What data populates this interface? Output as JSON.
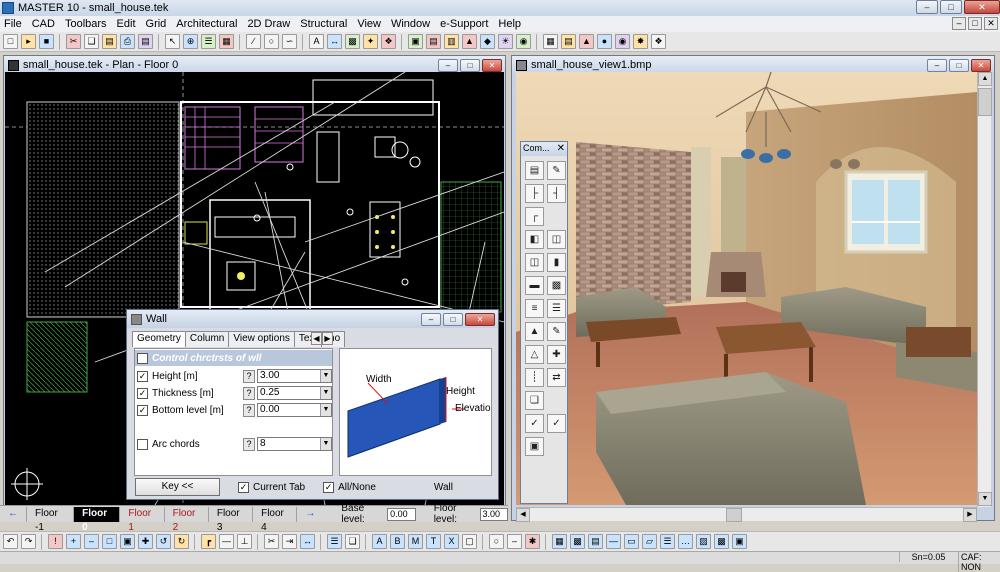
{
  "app": {
    "title": "MASTER 10 - small_house.tek"
  },
  "menu": [
    "File",
    "CAD",
    "Toolbars",
    "Edit",
    "Grid",
    "Architectural",
    "2D Draw",
    "Structural",
    "View",
    "Window",
    "e-Support",
    "Help"
  ],
  "plan_window": {
    "title": "small_house.tek - Plan - Floor 0"
  },
  "render_window": {
    "title": "small_house_view1.bmp"
  },
  "command_palette": {
    "title": "Com..."
  },
  "floor_tabs": [
    "Floor -1",
    "Floor 0",
    "Floor 1",
    "Floor 2",
    "Floor 3",
    "Floor 4"
  ],
  "floor_bar": {
    "active_tab": "Floor 0",
    "base_level_label": "Base level:",
    "base_level_value": "0.00",
    "floor_level_label": "Floor level:",
    "floor_level_value": "3.00"
  },
  "wall_dialog": {
    "title": "Wall",
    "tabs": [
      "Geometry",
      "Column",
      "View options",
      "Text",
      "Ino"
    ],
    "section_header": "Control chrctrsts of wll",
    "properties": [
      {
        "label": "Height [m]",
        "value": "3.00",
        "checked": true
      },
      {
        "label": "Thickness [m]",
        "value": "0.25",
        "checked": true
      },
      {
        "label": "Bottom level [m]",
        "value": "0.00",
        "checked": true
      },
      {
        "label": "Arc chords",
        "value": "8",
        "checked": false
      }
    ],
    "preview_labels": {
      "width": "Width",
      "height": "Height",
      "elevation": "Elevation"
    },
    "key_button": "Key <<",
    "current_tab_label": "Current Tab",
    "all_none_label": "All/None",
    "footer_caption": "Wall"
  },
  "status": {
    "snap": "Sn=0.05",
    "mode": "CAF: NON"
  },
  "colors": {
    "plan_bg": "#000000",
    "wall_preview_blue": "#2556b8",
    "active_floor_tab": "#000000",
    "red_floor_tab": "#b3151a"
  }
}
